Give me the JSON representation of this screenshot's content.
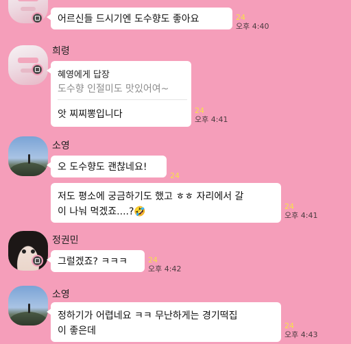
{
  "messages": [
    {
      "text": "어르신들 드시기엔 도수향도 좋아요",
      "unread": "24",
      "time": "오후 4:40"
    },
    {
      "sender": "희령",
      "reply_title": "혜영에게 답장",
      "reply_quote": "도수향 인절미도 맛있어여~",
      "text": "앗 찌찌뽕입니다",
      "unread": "24",
      "time": "오후 4:41"
    },
    {
      "sender": "소영",
      "text": "오 도수향도 괜찮네요!",
      "unread": "24"
    },
    {
      "text_line1": "저도 평소에 궁금하기도 했고 ㅎㅎ 자리에서 갈",
      "text_line2": "이 나눠 먹겠죠....?",
      "emoji": "🤣",
      "unread": "24",
      "time": "오후 4:41"
    },
    {
      "sender": "정권민",
      "text": "그럴겠죠? ㅋㅋㅋ",
      "unread": "24",
      "time": "오후 4:42"
    },
    {
      "sender": "소영",
      "text_line1": "정하기가 어렵네요 ㅋㅋ 무난하게는 경기떡집",
      "text_line2": "이 좋은데",
      "unread": "24",
      "time": "오후 4:43"
    }
  ],
  "icons": {
    "badge": "profile-badge-icon"
  }
}
